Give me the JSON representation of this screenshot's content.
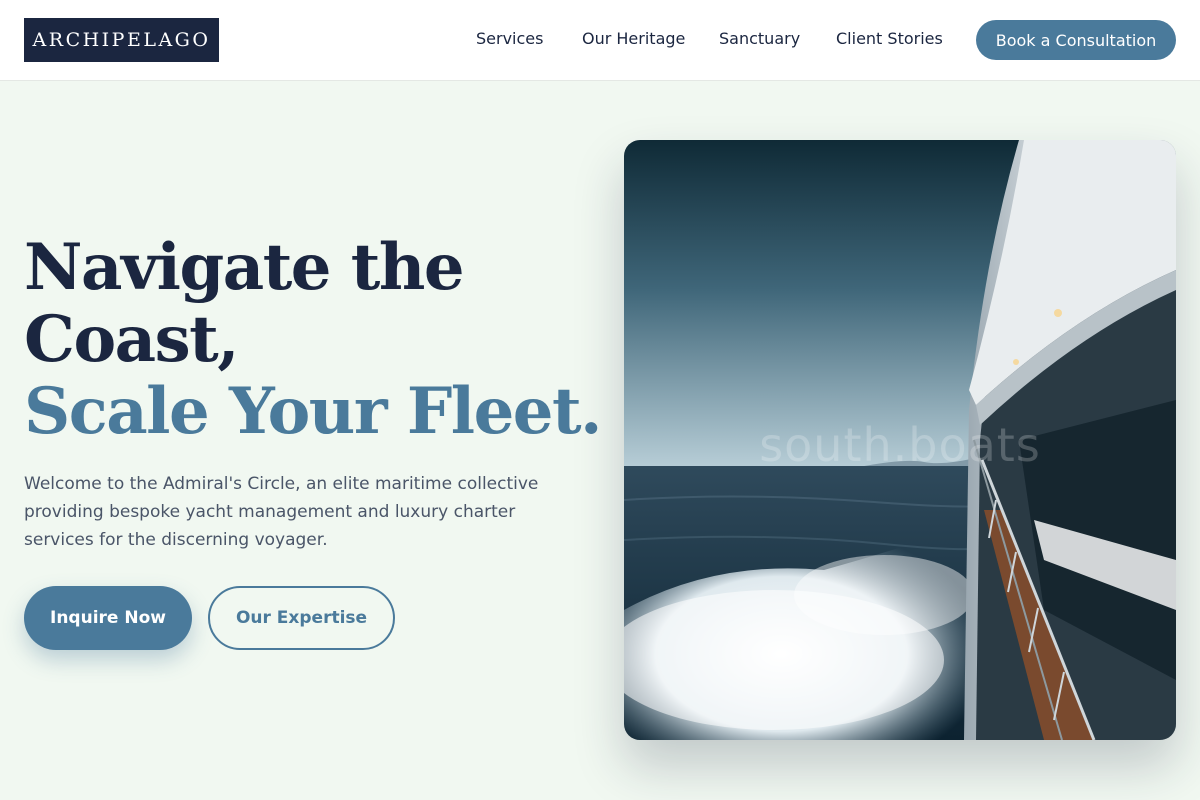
{
  "brand": {
    "logo_text": "ARCHIPELAGO"
  },
  "nav": {
    "items": [
      {
        "label": "Services"
      },
      {
        "label": "Our Heritage"
      },
      {
        "label": "Sanctuary"
      },
      {
        "label": "Client Stories"
      }
    ],
    "cta_label": "Book a Consultation"
  },
  "hero": {
    "headline_line1": "Navigate the",
    "headline_line2": "Coast,",
    "headline_accent": "Scale Your Fleet.",
    "lead": "Welcome to the Admiral's Circle, an elite maritime collective providing bespoke yacht management and luxury charter services for the discerning voyager.",
    "primary_button": "Inquire Now",
    "secondary_button": "Our Expertise",
    "image": {
      "subject": "luxury yacht side deck with ocean wake",
      "watermark_text": "south.boats"
    }
  },
  "colors": {
    "navy": "#1b2640",
    "accent": "#4a7a9b",
    "background": "#f1f8f1",
    "muted_text": "#4a5568"
  }
}
